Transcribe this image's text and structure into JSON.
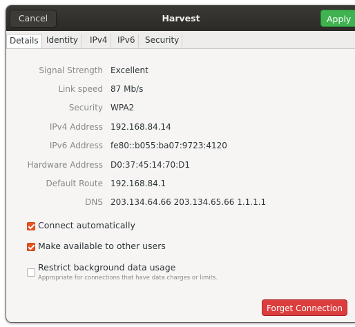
{
  "header": {
    "cancel_label": "Cancel",
    "title": "Harvest",
    "apply_label": "Apply"
  },
  "tabs": [
    {
      "label": "Details",
      "active": true
    },
    {
      "label": "Identity",
      "active": false
    },
    {
      "label": "IPv4",
      "active": false
    },
    {
      "label": "IPv6",
      "active": false
    },
    {
      "label": "Security",
      "active": false
    }
  ],
  "details": [
    {
      "label": "Signal Strength",
      "value": "Excellent"
    },
    {
      "label": "Link speed",
      "value": "87 Mb/s"
    },
    {
      "label": "Security",
      "value": "WPA2"
    },
    {
      "label": "IPv4 Address",
      "value": "192.168.84.14"
    },
    {
      "label": "IPv6 Address",
      "value": "fe80::b055:ba07:9723:4120"
    },
    {
      "label": "Hardware Address",
      "value": "D0:37:45:14:70:D1"
    },
    {
      "label": "Default Route",
      "value": "192.168.84.1"
    },
    {
      "label": "DNS",
      "value": "203.134.64.66 203.134.65.66 1.1.1.1"
    }
  ],
  "options": {
    "connect_automatically": {
      "label": "Connect automatically",
      "checked": true
    },
    "available_to_others": {
      "label": "Make available to other users",
      "checked": true
    },
    "restrict_background": {
      "label": "Restrict background data usage",
      "description": "Appropriate for connections that have data charges or limits.",
      "checked": false
    }
  },
  "forget_label": "Forget Connection",
  "colors": {
    "accent": "#e95420",
    "apply": "#3eb34f",
    "destructive": "#dc3d3d",
    "headerbar": "#2b2a27"
  }
}
